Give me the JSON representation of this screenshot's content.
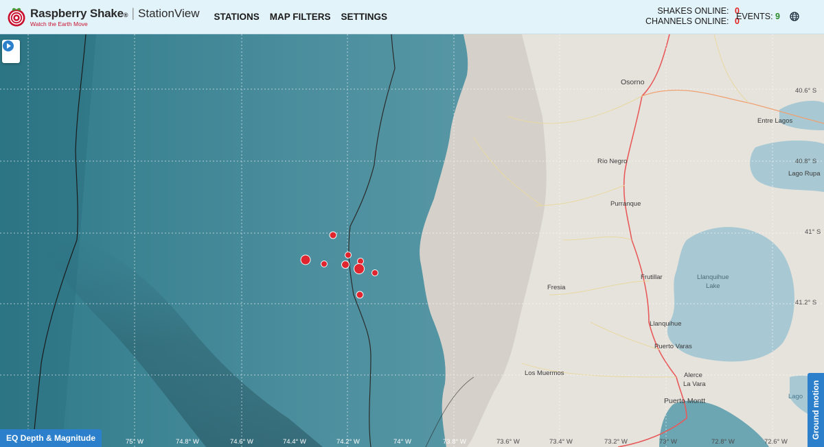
{
  "header": {
    "brand_name": "Raspberry Shake",
    "brand_mark": "®",
    "brand_sep": "|",
    "product": "StationView",
    "tagline": "Watch the Earth Move",
    "nav": [
      {
        "label": "STATIONS"
      },
      {
        "label": "MAP FILTERS"
      },
      {
        "label": "SETTINGS"
      }
    ],
    "shakes_online_label": "SHAKES ONLINE:",
    "shakes_online_value": "0",
    "channels_online_label": "CHANNELS ONLINE:",
    "channels_online_value": "0",
    "events_label": "EVENTS:",
    "events_value": "9",
    "globe_icon": "globe-icon"
  },
  "map": {
    "play_icon": "play-icon",
    "places": [
      {
        "name": "Osorno"
      },
      {
        "name": "Entre Lagos"
      },
      {
        "name": "Río Negro"
      },
      {
        "name": "Lago Rupa"
      },
      {
        "name": "Purranque"
      },
      {
        "name": "Frutillar"
      },
      {
        "name": "Llanquihue\nLake"
      },
      {
        "name": "Fresia"
      },
      {
        "name": "Llanquihue"
      },
      {
        "name": "Puerto Varas"
      },
      {
        "name": "Los Muermos"
      },
      {
        "name": "Alerce"
      },
      {
        "name": "La Vara"
      },
      {
        "name": "Puerto Montt"
      },
      {
        "name": "Lago"
      }
    ],
    "lat_labels": [
      "40.6° S",
      "40.8° S",
      "41° S",
      "41.2° S"
    ],
    "lon_labels": [
      "75° W",
      "74.8° W",
      "74.6° W",
      "74.4° W",
      "74.2° W",
      "74° W",
      "73.8° W",
      "73.6° W",
      "73.4° W",
      "73.2° W",
      "73° W",
      "72.8° W",
      "72.6° W"
    ],
    "earthquakes_count": 9,
    "colors": {
      "ocean": "#4f8e9c",
      "land": "#e6e3dd",
      "event": "#e8202a",
      "accent": "#2b7fcb"
    }
  },
  "legend_button": "EQ Depth & Magnitude",
  "ground_motion_tab": "Ground motion"
}
